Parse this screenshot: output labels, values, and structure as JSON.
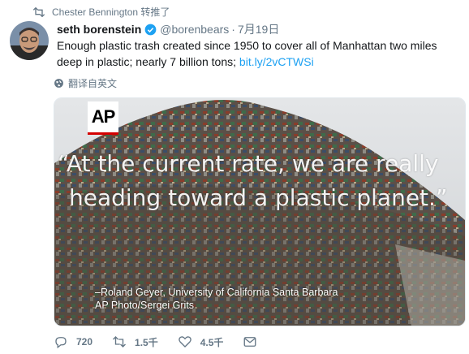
{
  "retweeter": {
    "text": "Chester Bennington 转推了",
    "icon": "retweet-icon"
  },
  "author": {
    "name": "seth borenstein",
    "handle": "@borenbears",
    "separator": "·",
    "time": "7月19日",
    "verified_color": "#1da1f2"
  },
  "tweet": {
    "text": "Enough plastic trash created since 1950 to cover all of Manhattan two miles deep in plastic; nearly 7 billion tons;",
    "link": "bit.ly/2vCTWSi",
    "link_color": "#1da1f2"
  },
  "translate": {
    "label": "翻译自英文",
    "icon": "globe-icon"
  },
  "media": {
    "logo": "AP",
    "quote_line1": "“At the current rate, we are really",
    "quote_line2": "heading toward a plastic planet.”",
    "credit_line1": "–Roland Geyer, University of California Santa Barbara",
    "credit_line2": "AP Photo/Sergei Grits"
  },
  "actions": {
    "reply": {
      "icon": "reply-icon",
      "count": "720"
    },
    "retweet": {
      "icon": "retweet-icon",
      "count": "1.5千"
    },
    "like": {
      "icon": "heart-icon",
      "count": "4.5千"
    },
    "message": {
      "icon": "mail-icon"
    }
  }
}
